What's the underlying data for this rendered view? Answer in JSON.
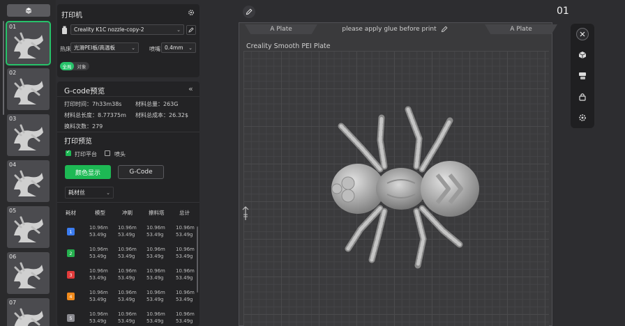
{
  "plates": {
    "numbers": [
      "01",
      "02",
      "03",
      "04",
      "05",
      "06",
      "07"
    ]
  },
  "printer": {
    "title": "打印机",
    "preset": "Creality K1C nozzle-copy-2",
    "bed_label": "热床",
    "bed_value": "光滑PEI板/高温板",
    "nozzle_label": "喷嘴",
    "nozzle_value": "0.4mm",
    "toggle_all": "全局",
    "toggle_object": "对象"
  },
  "gcode": {
    "title": "G-code预览",
    "collapse": "«",
    "print_time": "打印时间：7h33m38s",
    "total_material": "材料总量：263G",
    "total_length": "材料总长度：8.77375m",
    "total_cost": "材料总成本：26.32$",
    "change_count": "换料次数：279"
  },
  "preview": {
    "title": "打印预览",
    "check_bed": "打印平台",
    "check_nozzle": "喷头",
    "btn_color": "颜色显示",
    "btn_gcode": "G-Code",
    "dropdown": "耗材丝"
  },
  "table": {
    "headers": [
      "耗材",
      "模型",
      "冲刷",
      "擦料塔",
      "总计"
    ],
    "rows": [
      {
        "id": "1",
        "color": "#3b7cf0",
        "cells": [
          "10.96m\n53.49g",
          "10.96m\n53.49g",
          "10.96m\n53.49g",
          "10.96m\n53.49g"
        ]
      },
      {
        "id": "2",
        "color": "#25b04e",
        "cells": [
          "10.96m\n53.49g",
          "10.96m\n53.49g",
          "10.96m\n53.49g",
          "10.96m\n53.49g"
        ]
      },
      {
        "id": "3",
        "color": "#e23b3b",
        "cells": [
          "10.96m\n53.49g",
          "10.96m\n53.49g",
          "10.96m\n53.49g",
          "10.96m\n53.49g"
        ]
      },
      {
        "id": "4",
        "color": "#f08a1c",
        "cells": [
          "10.96m\n53.49g",
          "10.96m\n53.49g",
          "10.96m\n53.49g",
          "10.96m\n53.49g"
        ]
      },
      {
        "id": "5",
        "color": "#8a8a90",
        "cells": [
          "10.96m\n53.49g",
          "10.96m\n53.49g",
          "10.96m\n53.49g",
          "10.96m\n53.49g"
        ]
      }
    ]
  },
  "viewport": {
    "plate_number": "01",
    "tab_left": "A Plate",
    "tab_center": "please apply glue before print",
    "tab_right": "A Plate",
    "plate_name": "Creality Smooth PEI Plate"
  }
}
